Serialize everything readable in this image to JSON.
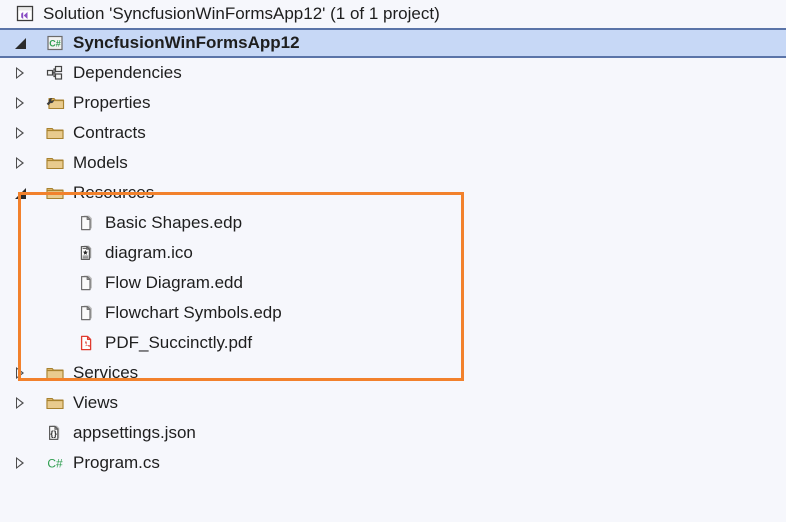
{
  "window": {
    "background_color": "#f6f7fc",
    "selection_color": "#c7d8f6",
    "selection_border_color": "#5a74a8",
    "highlight_color": "#f2812c"
  },
  "solution": {
    "icon": "solution-icon",
    "label": "Solution 'SyncfusionWinFormsApp12' (1 of 1 project)"
  },
  "project": {
    "icon": "csharp-project-icon",
    "label": "SyncfusionWinFormsApp12",
    "expander": "expanded",
    "selected": true
  },
  "nodes": [
    {
      "label": "Dependencies",
      "icon": "dependencies-icon",
      "expander": "collapsed",
      "depth": 2
    },
    {
      "label": "Properties",
      "icon": "properties-folder-icon",
      "expander": "collapsed",
      "depth": 2
    },
    {
      "label": "Contracts",
      "icon": "folder-icon",
      "expander": "collapsed",
      "depth": 2
    },
    {
      "label": "Models",
      "icon": "folder-icon",
      "expander": "collapsed",
      "depth": 2
    },
    {
      "label": "Resources",
      "icon": "folder-icon",
      "expander": "expanded",
      "depth": 2,
      "highlighted": true
    },
    {
      "label": "Basic Shapes.edp",
      "icon": "file-icon",
      "expander": "none",
      "depth": 3,
      "highlighted": true
    },
    {
      "label": "diagram.ico",
      "icon": "ico-file-icon",
      "expander": "none",
      "depth": 3,
      "highlighted": true
    },
    {
      "label": "Flow Diagram.edd",
      "icon": "file-icon",
      "expander": "none",
      "depth": 3,
      "highlighted": true
    },
    {
      "label": "Flowchart Symbols.edp",
      "icon": "file-icon",
      "expander": "none",
      "depth": 3,
      "highlighted": true
    },
    {
      "label": "PDF_Succinctly.pdf",
      "icon": "pdf-file-icon",
      "expander": "none",
      "depth": 3,
      "highlighted": true
    },
    {
      "label": "Services",
      "icon": "folder-icon",
      "expander": "collapsed",
      "depth": 2
    },
    {
      "label": "Views",
      "icon": "folder-icon",
      "expander": "collapsed",
      "depth": 2
    },
    {
      "label": "appsettings.json",
      "icon": "json-file-icon",
      "expander": "none",
      "depth": 2
    },
    {
      "label": "Program.cs",
      "icon": "csharp-file-icon",
      "expander": "collapsed",
      "depth": 2
    }
  ]
}
